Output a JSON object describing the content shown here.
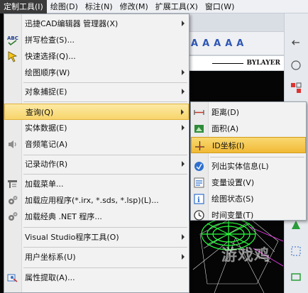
{
  "menubar": {
    "items": [
      {
        "label": "定制工具(I)",
        "active": true
      },
      {
        "label": "绘图(D)",
        "active": false
      },
      {
        "label": "标注(N)",
        "active": false
      },
      {
        "label": "修改(M)",
        "active": false
      },
      {
        "label": "扩展工具(X)",
        "active": false
      },
      {
        "label": "窗口(W)",
        "active": false
      }
    ]
  },
  "toolbar": {
    "linetype_label": "BYLAYER"
  },
  "main_menu": {
    "items": [
      {
        "label": "迅捷CAD编辑器 管理器(X)",
        "submenu": true,
        "icon": "none"
      },
      {
        "label": "拼写检查(S)...",
        "submenu": false,
        "icon": "spellcheck-icon"
      },
      {
        "label": "快速选择(Q)...",
        "submenu": false,
        "icon": "quick-select-icon"
      },
      {
        "label": "绘图顺序(W)",
        "submenu": true,
        "icon": "none"
      },
      {
        "label": "对象捕捉(E)",
        "submenu": true,
        "icon": "none"
      },
      {
        "label": "查询(Q)",
        "submenu": true,
        "icon": "none"
      },
      {
        "label": "实体数据(E)",
        "submenu": true,
        "icon": "none"
      },
      {
        "label": "音频笔记(A)",
        "submenu": false,
        "icon": "speaker-icon"
      },
      {
        "label": "记录动作(R)",
        "submenu": true,
        "icon": "none"
      },
      {
        "label": "加载菜单...",
        "submenu": false,
        "icon": "load-menu-icon"
      },
      {
        "label": "加载应用程序(*.irx, *.sds, *.lsp)(L)...",
        "submenu": false,
        "icon": "gear-icon"
      },
      {
        "label": "加载经典 .NET 程序...",
        "submenu": false,
        "icon": "gear-icon"
      },
      {
        "label": "Visual Studio程序工具(O)",
        "submenu": true,
        "icon": "none"
      },
      {
        "label": "用户坐标系(U)",
        "submenu": true,
        "icon": "none"
      },
      {
        "label": "属性提取(A)...",
        "submenu": false,
        "icon": "attribute-extract-icon"
      }
    ]
  },
  "query_submenu": {
    "items": [
      {
        "label": "距离(D)",
        "icon": "distance-icon"
      },
      {
        "label": "面积(A)",
        "icon": "area-icon"
      },
      {
        "label": "ID坐标(I)",
        "icon": "id-coordinate-icon"
      },
      {
        "label": "列出实体信息(L)",
        "icon": "list-info-icon"
      },
      {
        "label": "变量设置(V)",
        "icon": "variable-settings-icon"
      },
      {
        "label": "绘图状态(S)",
        "icon": "drawing-status-icon"
      },
      {
        "label": "时间变量(T)",
        "icon": "clock-icon"
      }
    ]
  },
  "watermark": "游戏鸡"
}
